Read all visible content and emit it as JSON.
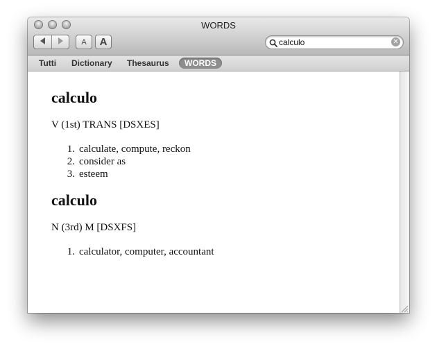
{
  "window": {
    "title": "WORDS"
  },
  "toolbar": {
    "back_icon": "left-triangle-icon",
    "forward_icon": "right-triangle-icon",
    "font_smaller_label": "A",
    "font_larger_label": "A",
    "search": {
      "value": "calculo",
      "placeholder": ""
    }
  },
  "tabs": [
    {
      "label": "Tutti",
      "active": false
    },
    {
      "label": "Dictionary",
      "active": false
    },
    {
      "label": "Thesaurus",
      "active": false
    },
    {
      "label": "WORDS",
      "active": true
    }
  ],
  "entries": [
    {
      "headword": "calculo",
      "grammar": "V (1st) TRANS [DSXES]",
      "senses": [
        {
          "n": "1.",
          "text": "calculate, compute, reckon"
        },
        {
          "n": "2.",
          "text": "consider as"
        },
        {
          "n": "3.",
          "text": "esteem"
        }
      ]
    },
    {
      "headword": "calculo",
      "grammar": "N (3rd) M [DSXFS]",
      "senses": [
        {
          "n": "1.",
          "text": "calculator, computer, accountant"
        }
      ]
    }
  ],
  "colors": {
    "active_tab_bg": "#8e8e8e",
    "titlebar_top": "#e9e9e9",
    "titlebar_bottom": "#b9b9b9"
  }
}
